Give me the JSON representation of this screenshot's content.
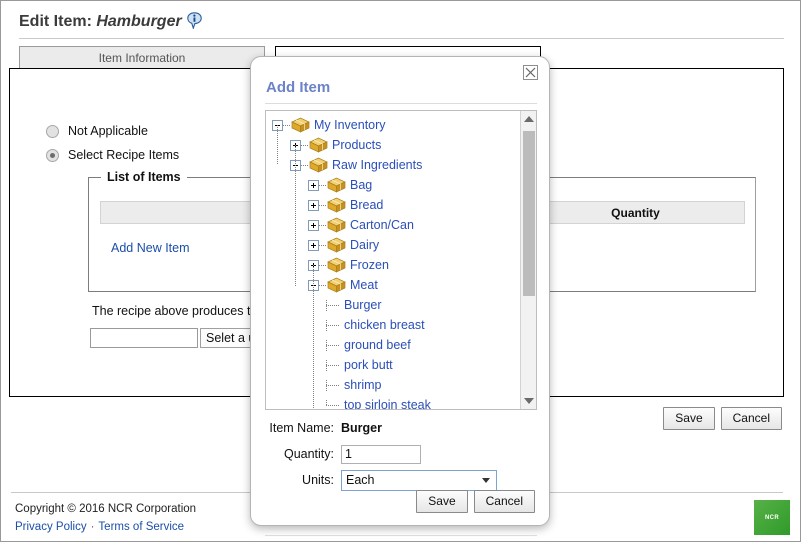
{
  "page": {
    "title_prefix": "Edit Item:",
    "item_name": "Hamburger",
    "info_icon": "info-icon"
  },
  "tabs": [
    {
      "label": "Item Information",
      "active": false
    },
    {
      "label": "",
      "active": true
    }
  ],
  "recipe": {
    "options": [
      {
        "label": "Not Applicable",
        "selected": false
      },
      {
        "label": "Select Recipe Items",
        "selected": true
      }
    ],
    "fieldset_legend": "List of Items",
    "columns": [
      "",
      "",
      "Quantity"
    ],
    "add_new_label": "Add New Item",
    "yield_text": "The recipe above produces the",
    "yield_qty": "",
    "yield_unit": "Selet a uni"
  },
  "page_actions": {
    "save_label": "Save",
    "cancel_label": "Cancel"
  },
  "footer": {
    "copyright": "Copyright © 2016 NCR Corporation",
    "privacy_label": "Privacy Policy",
    "separator": "·",
    "terms_label": "Terms of Service",
    "logo_text": "NCR"
  },
  "modal": {
    "title": "Add Item",
    "close_icon": "close-icon",
    "tree": [
      {
        "label": "My Inventory",
        "depth": 0,
        "toggle": "minus"
      },
      {
        "label": "Products",
        "depth": 1,
        "toggle": "plus"
      },
      {
        "label": "Raw Ingredients",
        "depth": 1,
        "toggle": "minus"
      },
      {
        "label": "Bag",
        "depth": 2,
        "toggle": "plus"
      },
      {
        "label": "Bread",
        "depth": 2,
        "toggle": "plus"
      },
      {
        "label": "Carton/Can",
        "depth": 2,
        "toggle": "plus"
      },
      {
        "label": "Dairy",
        "depth": 2,
        "toggle": "plus"
      },
      {
        "label": "Frozen",
        "depth": 2,
        "toggle": "plus"
      },
      {
        "label": "Meat",
        "depth": 2,
        "toggle": "minus"
      },
      {
        "label": "Burger",
        "depth": 3,
        "toggle": "leaf"
      },
      {
        "label": "chicken breast",
        "depth": 3,
        "toggle": "leaf"
      },
      {
        "label": "ground beef",
        "depth": 3,
        "toggle": "leaf"
      },
      {
        "label": "pork butt",
        "depth": 3,
        "toggle": "leaf"
      },
      {
        "label": "shrimp",
        "depth": 3,
        "toggle": "leaf"
      },
      {
        "label": "top sirloin steak",
        "depth": 3,
        "toggle": "leaf"
      }
    ],
    "form": {
      "item_name_label": "Item Name:",
      "item_name_value": "Burger",
      "quantity_label": "Quantity:",
      "quantity_value": "1",
      "units_label": "Units:",
      "units_value": "Each"
    },
    "save_label": "Save",
    "cancel_label": "Cancel"
  },
  "colors": {
    "link": "#2a4fb8",
    "modal_title": "#6c82c9",
    "box_icon": "#e0a825",
    "logo_green": "#3fa535"
  }
}
